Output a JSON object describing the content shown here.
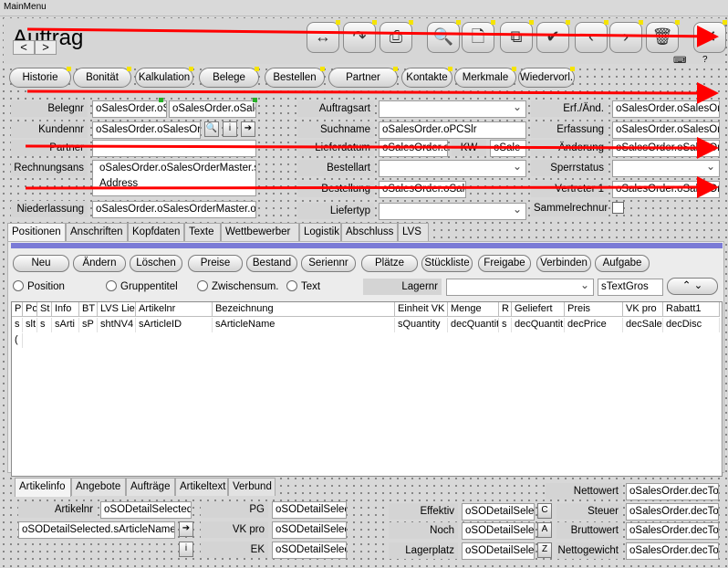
{
  "window": {
    "title": "MainMenu"
  },
  "form": {
    "title": "Auftrag"
  },
  "nav_mini": {
    "back": "<",
    "forward": ">"
  },
  "toolbar": {
    "buttons": [
      {
        "name": "resize-icon",
        "glyph": "↔"
      },
      {
        "name": "redo-icon",
        "glyph": "↷"
      },
      {
        "name": "print-icon",
        "glyph": "⎙"
      },
      {
        "name": "search-icon",
        "glyph": "🔍"
      },
      {
        "name": "new-document-icon",
        "glyph": "🗋"
      },
      {
        "name": "copy-icon",
        "glyph": "⧉"
      },
      {
        "name": "checkmark-icon",
        "glyph": "✔"
      },
      {
        "name": "chevron-left-icon",
        "glyph": "‹"
      },
      {
        "name": "chevron-right-icon",
        "glyph": "›"
      },
      {
        "name": "trash-icon",
        "glyph": "🗑"
      },
      {
        "name": "close-icon",
        "glyph": "✕"
      }
    ],
    "help": "?"
  },
  "top_tabs": [
    "Historie",
    "Bonität",
    "Kalkulation",
    "Belege",
    "Bestellen",
    "Partner",
    "Kontakte",
    "Merkmale",
    "Wiedervorl."
  ],
  "fields": {
    "belegnr": {
      "label": "Belegnr",
      "value1": "oSalesOrder.oS",
      "value2": "oSalesOrder.oSale"
    },
    "kundennr": {
      "label": "Kundennr",
      "value": "oSalesOrder.oSalesOrd"
    },
    "partner": {
      "label": "Partner",
      "value": ""
    },
    "rechnungsans": {
      "label": "Rechnungsans",
      "value1": "oSalesOrder.oSalesOrderMaster.sl",
      "value2": "Address"
    },
    "niederlassung": {
      "label": "Niederlassung",
      "value": "oSalesOrder.oSalesOrderMaster.oBi"
    },
    "auftragsart": {
      "label": "Auftragsart",
      "value": ""
    },
    "suchname": {
      "label": "Suchname",
      "value": "oSalesOrder.oPCSlr"
    },
    "lieferdatum": {
      "label": "Lieferdatum",
      "value": "oSalesOrder.o"
    },
    "kw": {
      "label": "KW",
      "value": "oSale"
    },
    "bestellart": {
      "label": "Bestellart",
      "value": ""
    },
    "bestellung": {
      "label": "Bestellung",
      "value": "oSalesOrder.oSale"
    },
    "liefertyp": {
      "label": "Liefertyp",
      "value": ""
    },
    "erf_aend": {
      "label": "Erf./Änd.",
      "value": "oSalesOrder.oSalesOrd"
    },
    "erfassung": {
      "label": "Erfassung",
      "value": "oSalesOrder.oSalesOrd"
    },
    "aenderung": {
      "label": "Änderung",
      "value": "oSalesOrder.oSalesOrd"
    },
    "sperrstatus": {
      "label": "Sperrstatus",
      "value": ""
    },
    "vertreter1": {
      "label": "Vertreter 1",
      "value": "oSalesOrder.oSalesOrd"
    },
    "sammelrechnung": {
      "label": "Sammelrechnun"
    }
  },
  "mid_tabs": [
    "Positionen",
    "Anschriften",
    "Kopfdaten",
    "Texte",
    "Wettbewerber",
    "Logistik",
    "Abschluss",
    "LVS"
  ],
  "actions": [
    "Neu",
    "Ändern",
    "Löschen",
    "Preise",
    "Bestand",
    "Seriennr",
    "Plätze",
    "Stückliste",
    "Freigabe",
    "Verbinden",
    "Aufgabe"
  ],
  "radios": [
    "Position",
    "Gruppentitel",
    "Zwischensum.",
    "Text"
  ],
  "lagernr": {
    "label": "Lagernr",
    "value": "",
    "text": "sTextGros"
  },
  "grid": {
    "columns": [
      "P",
      "Po",
      "St",
      "Info",
      "BT",
      "LVS Lie",
      "Artikelnr",
      "Bezeichnung",
      "Einheit VK",
      "Menge",
      "R",
      "Geliefert",
      "Preis",
      "VK pro",
      "Rabatt1"
    ],
    "row1": [
      "s",
      "slt",
      "s",
      "sArti",
      "sP",
      "shtNV4",
      "sArticleID",
      "sArticleName",
      "sQuantity",
      "decQuantit",
      "s",
      "decQuantit",
      "decPrice",
      "decSale",
      "decDisc"
    ],
    "row2_first": "("
  },
  "bottom_tabs": [
    "Artikelinfo",
    "Angebote",
    "Aufträge",
    "Artikeltext",
    "Verbund"
  ],
  "bottom": {
    "artikelnr": {
      "label": "Artikelnr",
      "value": "oSODetailSelected.s"
    },
    "articlename": "oSODetailSelected.sArticleName",
    "pg": {
      "label": "PG",
      "value": "oSODetailSelec"
    },
    "vkpro": {
      "label": "VK pro",
      "value": "oSODetailSelec"
    },
    "ek": {
      "label": "EK",
      "value": "oSODetailSelec"
    },
    "effektiv": {
      "label": "Effektiv",
      "value": "oSODetailSelec",
      "btn": "C"
    },
    "noch": {
      "label": "Noch",
      "value": "oSODetailSelec",
      "btn": "A"
    },
    "lagerplatz": {
      "label": "Lagerplatz",
      "value": "oSODetailSelec",
      "btn": "Z"
    },
    "nettowert": {
      "label": "Nettowert",
      "value": "oSalesOrder.decTot"
    },
    "steuer": {
      "label": "Steuer",
      "value": "oSalesOrder.decTot"
    },
    "bruttowert": {
      "label": "Bruttowert",
      "value": "oSalesOrder.decTot"
    },
    "nettogewicht": {
      "label": "Nettogewicht",
      "value": "oSalesOrder.decTot"
    }
  }
}
